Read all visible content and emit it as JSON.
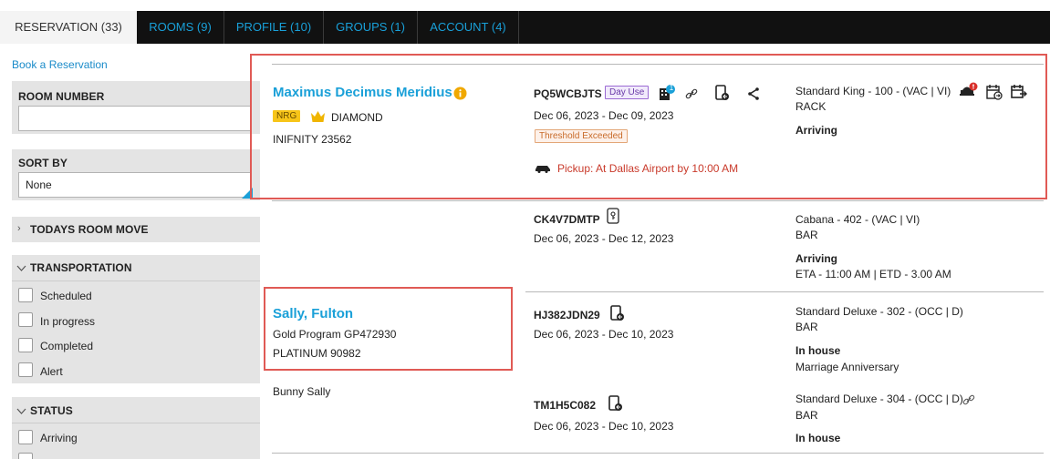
{
  "tabs": [
    {
      "label": "RESERVATION (33)",
      "active": true
    },
    {
      "label": "ROOMS (9)"
    },
    {
      "label": "PROFILE (10)"
    },
    {
      "label": "GROUPS (1)"
    },
    {
      "label": "ACCOUNT (4)"
    }
  ],
  "sidebar": {
    "book_link": "Book a Reservation",
    "room_number": {
      "label": "ROOM NUMBER",
      "value": ""
    },
    "sort_by": {
      "label": "SORT BY",
      "value": "None"
    },
    "todays_room_move": "TODAYS ROOM MOVE",
    "transportation": {
      "label": "TRANSPORTATION",
      "options": [
        "Scheduled",
        "In progress",
        "Completed",
        "Alert"
      ]
    },
    "status": {
      "label": "STATUS",
      "options": [
        "Arriving"
      ]
    }
  },
  "reservations": [
    {
      "guest": "Maximus Decimus Meridius",
      "badge": "NRG",
      "tier": "DIAMOND",
      "program": "INIFNITY 23562",
      "code": "PQ5WCBJTS",
      "tag": "Day Use",
      "notification_count": "1",
      "dates": "Dec 06, 2023 - Dec 09, 2023",
      "alert": "Threshold Exceeded",
      "pickup": "Pickup: At Dallas Airport by 10:00 AM",
      "room": "Standard King - 100 - (VAC | VI)",
      "rate": "RACK",
      "status": "Arriving"
    },
    {
      "code": "CK4V7DMTP",
      "dates": "Dec 06, 2023 - Dec 12, 2023",
      "room": "Cabana - 402 - (VAC | VI)",
      "rate": "BAR",
      "status": "Arriving",
      "eta": "ETA - 11:00 AM | ETD - 3.00 AM"
    },
    {
      "guest": "Sally, Fulton",
      "program": "Gold Program GP472930",
      "tier": "PLATINUM 90982",
      "code": "HJ382JDN29",
      "dates": "Dec 06, 2023 - Dec 10, 2023",
      "room": "Standard Deluxe - 302 - (OCC | D)",
      "rate": "BAR",
      "status": "In house",
      "note": "Marriage Anniversary"
    },
    {
      "guest": "Bunny Sally",
      "code": "TM1H5C082",
      "dates": "Dec 06, 2023 - Dec 10, 2023",
      "room": "Standard Deluxe - 304 - (OCC | D)",
      "rate": "BAR",
      "status": "In house"
    }
  ],
  "colors": {
    "accent": "#1aa0d8",
    "tabbar": "#111111",
    "highlight": "#e05a55",
    "alert_red": "#c93a2b"
  }
}
